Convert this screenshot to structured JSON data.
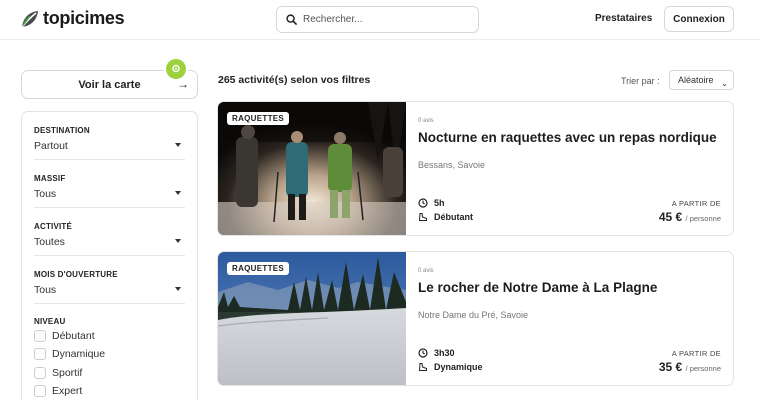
{
  "header": {
    "logo_text": "topicimes",
    "search_placeholder": "Rechercher...",
    "nav_providers": "Prestataires",
    "login_label": "Connexion"
  },
  "map_button": {
    "label": "Voir la carte",
    "arrow": "→"
  },
  "filters": {
    "groups": [
      {
        "title": "DESTINATION",
        "value": "Partout"
      },
      {
        "title": "MASSIF",
        "value": "Tous"
      },
      {
        "title": "ACTIVITÉ",
        "value": "Toutes"
      },
      {
        "title": "MOIS D'OUVERTURE",
        "value": "Tous"
      }
    ],
    "niveau_title": "NIVEAU",
    "niveau_options": [
      "Débutant",
      "Dynamique",
      "Sportif",
      "Expert"
    ]
  },
  "results": {
    "count_label": "265 activité(s) selon vos filtres",
    "sort_label": "Trier par :",
    "sort_value": "Aléatoire"
  },
  "cards": [
    {
      "badge": "RAQUETTES",
      "reviews": "0 avis",
      "title": "Nocturne en raquettes avec un repas nordique",
      "location": "Bessans, Savoie",
      "duration": "5h",
      "level": "Débutant",
      "price_from": "A PARTIR DE",
      "price": "45 €",
      "price_unit": "/ personne"
    },
    {
      "badge": "RAQUETTES",
      "reviews": "0 avis",
      "title": "Le rocher de Notre Dame à La Plagne",
      "location": "Notre Dame du Pré, Savoie",
      "duration": "3h30",
      "level": "Dynamique",
      "price_from": "A PARTIR DE",
      "price": "35 €",
      "price_unit": "/ personne"
    }
  ],
  "colors": {
    "accent": "#9cd23c",
    "logo_green": "#2e7d32",
    "border": "#d8d8d8"
  }
}
